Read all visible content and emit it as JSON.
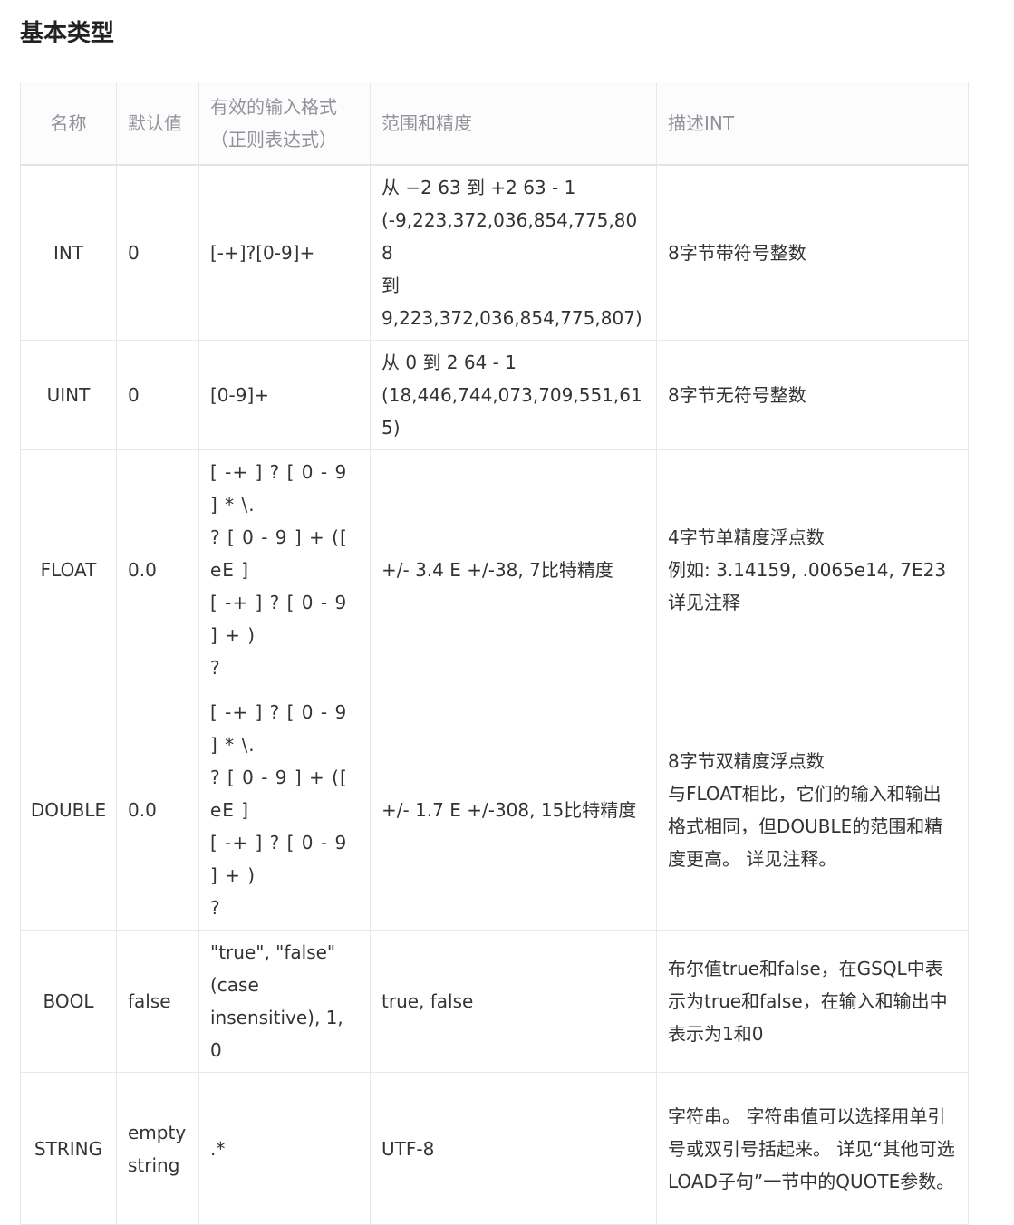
{
  "heading": "基本类型",
  "table": {
    "headers": [
      "名称",
      "默认值",
      "有效的输入格式\n（正则表达式）",
      "范围和精度",
      "描述INT"
    ],
    "rows": [
      {
        "name": "INT",
        "default": "0",
        "format": "[-+]?[0-9]+",
        "range": "从 −2 63 到 +2 63 - 1\n(-9,223,372,036,854,775,808\n到\n9,223,372,036,854,775,807)",
        "desc": "8字节带符号整数"
      },
      {
        "name": "UINT",
        "default": "0",
        "format": "[0-9]+",
        "range": "从 0 到 2 64 - 1\n(18,446,744,073,709,551,615)",
        "desc": "8字节无符号整数"
      },
      {
        "name": "FLOAT",
        "default": "0.0",
        "format": "[ -+ ] ? [ 0 - 9 ] * \\.\n? [ 0 - 9 ] + ([ eE ]\n[ -+ ] ? [ 0 - 9 ] + )\n?",
        "range": "+/- 3.4 E +/-38, 7比特精度",
        "desc": "4字节单精度浮点数\n例如: 3.14159, .0065e14, 7E23\n详见注释"
      },
      {
        "name": "DOUBLE",
        "default": "0.0",
        "format": "[ -+ ] ? [ 0 - 9 ] * \\.\n? [ 0 - 9 ] + ([ eE ]\n[ -+ ] ? [ 0 - 9 ] + )\n?",
        "range": "+/- 1.7 E +/-308, 15比特精度",
        "desc": "8字节双精度浮点数\n与FLOAT相比，它们的输入和输出格式相同，但DOUBLE的范围和精度更高。 详见注释。"
      },
      {
        "name": "BOOL",
        "default": "false",
        "format": "\"true\", \"false\"\n(case\ninsensitive), 1, 0",
        "range": "true, false",
        "desc": "布尔值true和false，在GSQL中表示为true和false，在输入和输出中表示为1和0"
      },
      {
        "name": "STRING",
        "default": "empty\nstring",
        "format": ".*",
        "range": "UTF-8",
        "desc": "字符串。 字符串值可以选择用单引号或双引号括起来。 详见“其他可选LOAD子句”一节中的QUOTE参数。"
      }
    ]
  }
}
